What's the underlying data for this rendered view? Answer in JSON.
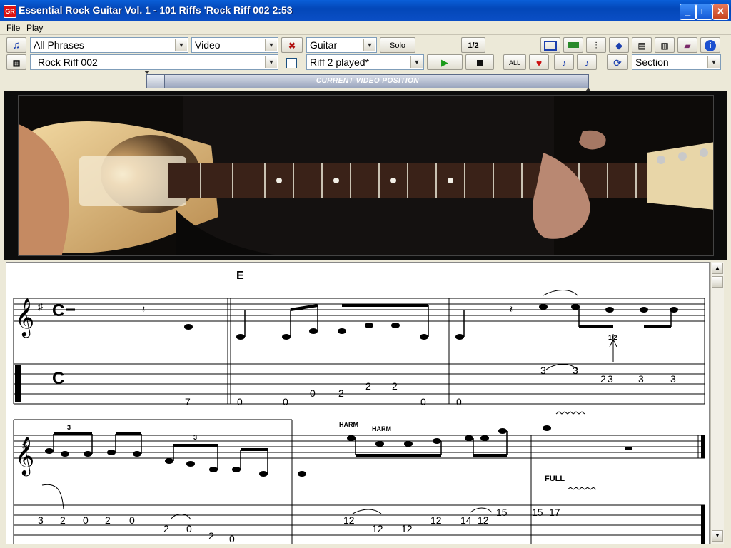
{
  "window": {
    "title": "Essential Rock Guitar Vol. 1 - 101 Riffs 'Rock Riff 002 2:53",
    "app_icon_label": "GR"
  },
  "menu": [
    "File",
    "Play"
  ],
  "toolbar1": {
    "phrase_select": "All Phrases",
    "view_select": "Video",
    "instrument_select": "Guitar",
    "solo_label": "Solo",
    "half_speed_label": "1/2"
  },
  "toolbar2": {
    "song_select": "Rock Riff 002",
    "riff_select": "Riff 2 played*",
    "all_label": "ALL",
    "section_select": "Section"
  },
  "video_position": {
    "label": "CURRENT VIDEO POSITION"
  },
  "score": {
    "rehearsal_mark": "E",
    "time_signature": "C",
    "annotations": {
      "bend_half": "1/2",
      "harm1": "HARM",
      "harm2": "HARM",
      "full": "FULL",
      "tuplet1": "3",
      "tuplet2": "3"
    },
    "staff1_frets": [
      "7",
      "0",
      "0",
      "0",
      "2",
      "2",
      "2",
      "0",
      "0",
      "3",
      "3",
      "2",
      "3",
      "3",
      "3"
    ],
    "staff2_frets": [
      "3",
      "2",
      "0",
      "2",
      "0",
      "2",
      "0",
      "2",
      "0",
      "12",
      "12",
      "12",
      "12",
      "14",
      "12",
      "15",
      "15",
      "17"
    ]
  },
  "colors": {
    "accent": "#0347b8",
    "play_green": "#1a9b1a",
    "heart_red": "#cc1010"
  }
}
